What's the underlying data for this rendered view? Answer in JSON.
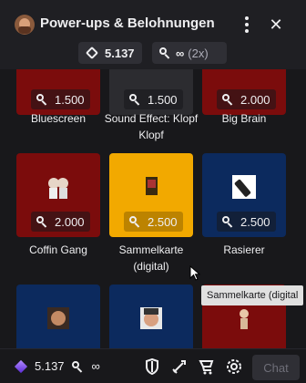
{
  "header": {
    "title": "Power-ups & Belohnungen",
    "points_value": "5.137",
    "keys_value": "∞",
    "keys_multiplier": "(2x)",
    "close_glyph": "✕"
  },
  "rewards": [
    {
      "label": "Bluescreen",
      "cost": "1.500",
      "color": "#7b0c0c"
    },
    {
      "label": "Sound Effect: Klopf Klopf",
      "cost": "1.500",
      "color": "#2c2c30"
    },
    {
      "label": "Big Brain",
      "cost": "2.000",
      "color": "#7b0c0c"
    },
    {
      "label": "Coffin Gang",
      "cost": "2.000",
      "color": "#7b0c0c"
    },
    {
      "label": "Sammelkarte (digital)",
      "cost": "2.500",
      "color": "#f2a900"
    },
    {
      "label": "Rasierer",
      "cost": "2.500",
      "color": "#0c2a5e"
    },
    {
      "label": "",
      "cost": "",
      "color": "#0c2a5e"
    },
    {
      "label": "",
      "cost": "",
      "color": "#0c2a5e"
    },
    {
      "label": "",
      "cost": "",
      "color": "#7b0c0c"
    }
  ],
  "tooltip": "Sammelkarte (digital",
  "footer": {
    "points_value": "5.137",
    "keys_value": "∞",
    "chat_label": "Chat"
  },
  "icons": [
    "channel-avatar-icon",
    "more-options-icon",
    "close-icon",
    "channel-points-icon",
    "key-icon",
    "shield-icon",
    "sword-icon",
    "cart-icon",
    "settings-icon"
  ]
}
